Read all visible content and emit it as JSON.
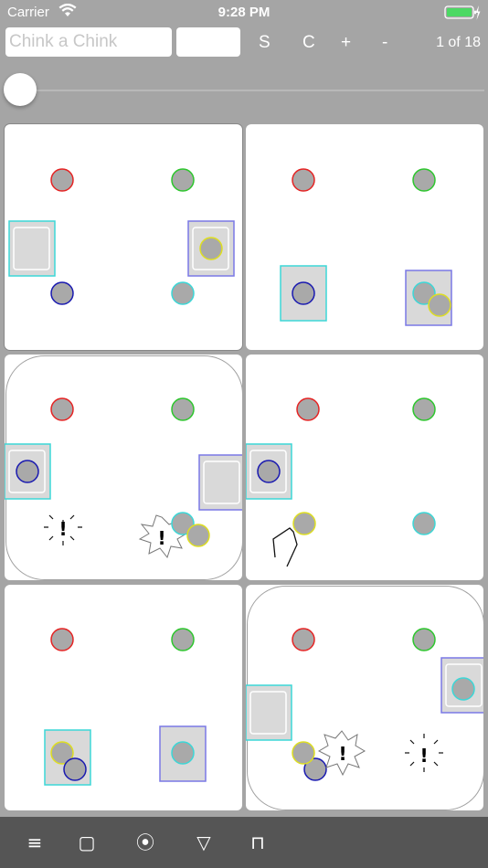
{
  "status_bar": {
    "carrier": "Carrier",
    "time": "9:28 PM"
  },
  "toolbar": {
    "name_placeholder": "Chink a Chink",
    "s_label": "S",
    "c_label": "C",
    "plus_label": "+",
    "minus_label": "-",
    "page_counter": "1 of 18"
  },
  "slider": {
    "value": 0.0
  },
  "icons": {
    "wifi": "wifi-icon",
    "battery": "battery-charging-icon",
    "menu": "menu-icon",
    "square": "square-icon",
    "circle": "target-icon",
    "triangle": "triangle-icon",
    "gate": "gate-icon"
  },
  "colors": {
    "red": "#e52424",
    "green": "#2ec62e",
    "blue": "#1a1ab0",
    "cyan": "#3cd7d7",
    "yellow": "#dede22",
    "purple": "#7a78e6",
    "ball_fill": "#a9a9a9",
    "panel_fill": "#d9d9d9"
  },
  "bottom_bar": {
    "menu_label": "≡",
    "square_label": "▢",
    "circle_label": "⦿",
    "triangle_label": "▽",
    "gate_label": "⊓"
  }
}
